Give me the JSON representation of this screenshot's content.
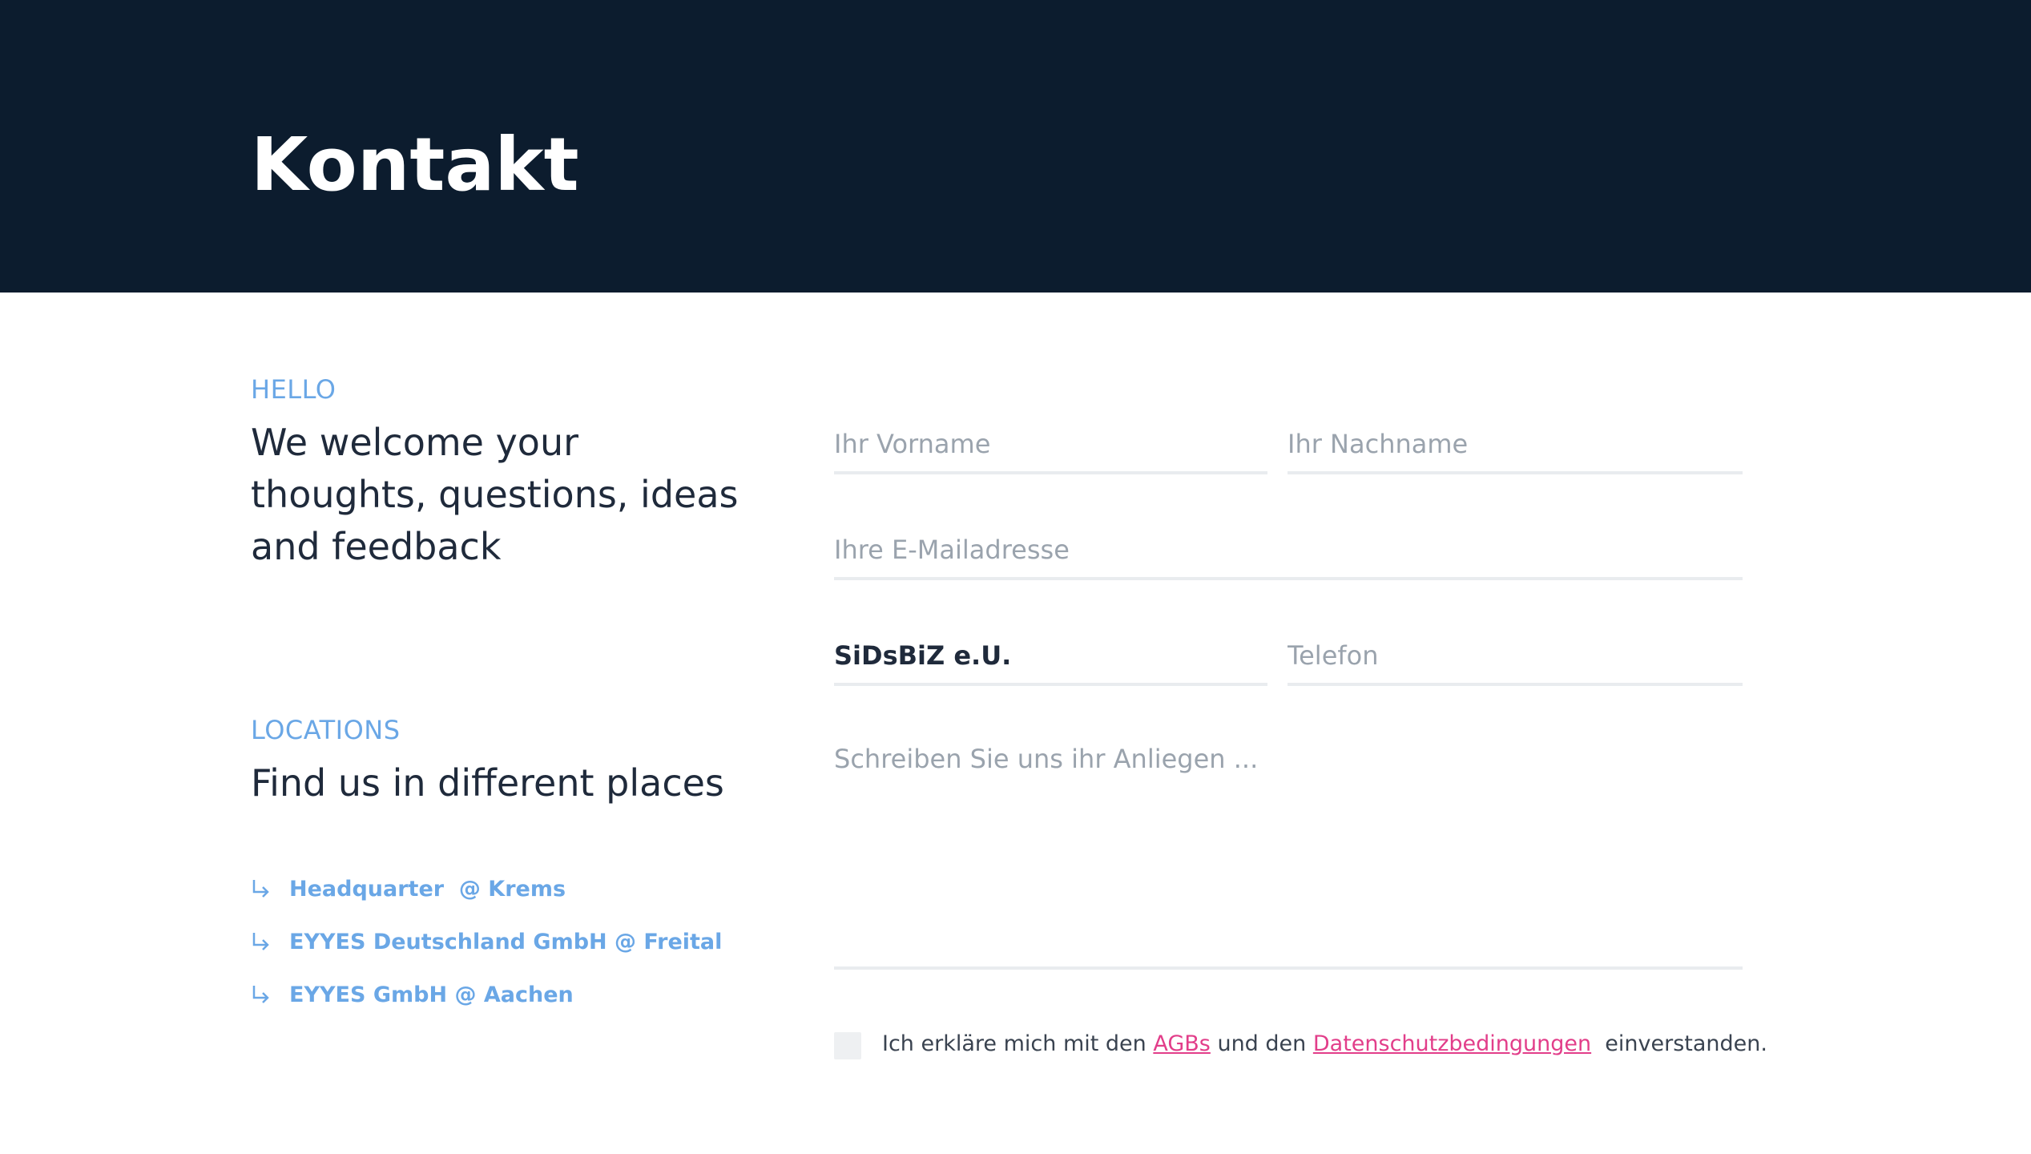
{
  "hero": {
    "title": "Kontakt"
  },
  "intro": {
    "eyebrow": "HELLO",
    "heading_line1": "We welcome your",
    "heading_line2": "thoughts, questions, ideas",
    "heading_line3": "and feedback"
  },
  "locations": {
    "eyebrow": "LOCATIONS",
    "heading": "Find us in different places",
    "items": [
      {
        "label": "Headquarter  @ Krems"
      },
      {
        "label": "EYYES Deutschland GmbH @ Freital"
      },
      {
        "label": "EYYES GmbH @ Aachen"
      }
    ]
  },
  "form": {
    "first_name_placeholder": "Ihr Vorname",
    "last_name_placeholder": "Ihr Nachname",
    "email_placeholder": "Ihre E-Mailadresse",
    "company_value": "SiDsBiZ e.U.",
    "phone_placeholder": "Telefon",
    "message_placeholder": "Schreiben Sie uns ihr Anliegen ..."
  },
  "consent": {
    "prefix": "Ich erkläre mich mit den ",
    "agb_link": "AGBs",
    "middle": " und den ",
    "privacy_link": "Datenschutzbedingungen",
    "suffix": "  einverstanden."
  },
  "colors": {
    "hero_bg": "#0c1c2e",
    "accent_blue": "#6aa7e6",
    "link_pink": "#e23e8a"
  }
}
